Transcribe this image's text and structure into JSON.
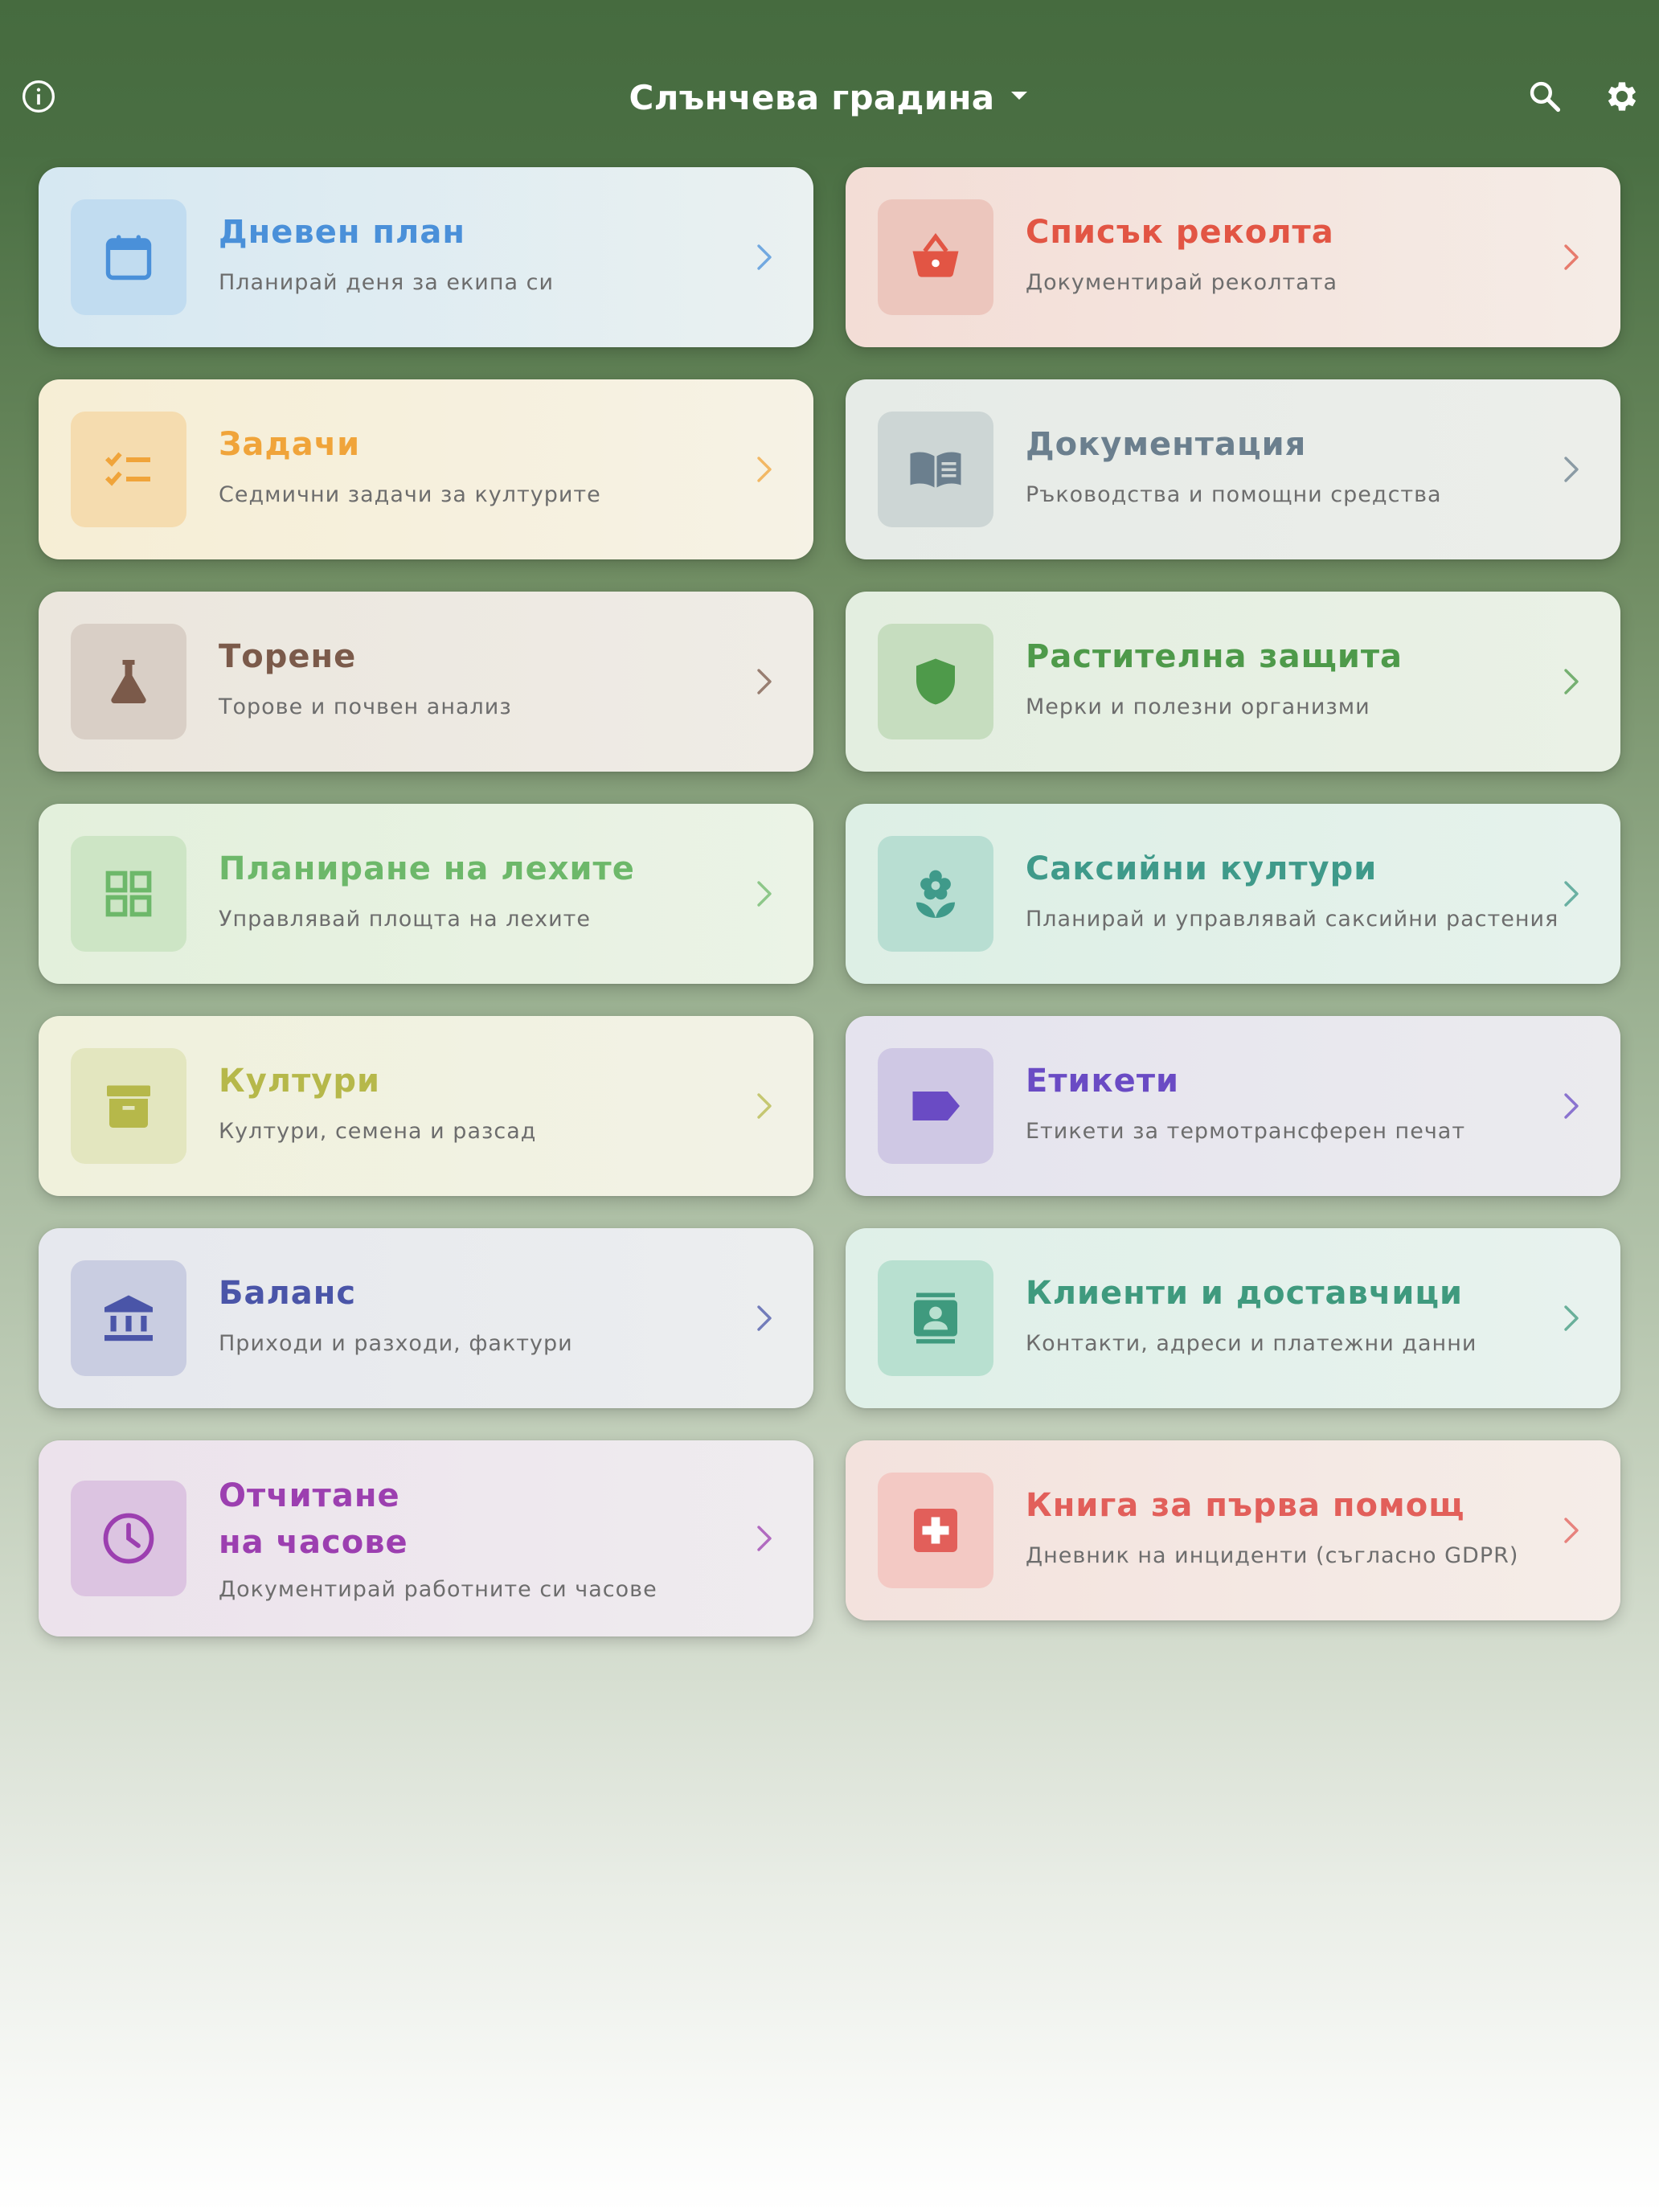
{
  "header": {
    "title": "Слънчева градина",
    "info_icon": "info-icon",
    "dropdown_icon": "caret-down-icon",
    "search_icon": "search-icon",
    "settings_icon": "gear-icon"
  },
  "cards": [
    {
      "id": "daily-plan",
      "title": "Дневен план",
      "subtitle": "Планирай деня за екипа си",
      "icon": "calendar-icon",
      "accent": "#4a90d9"
    },
    {
      "id": "harvest-list",
      "title": "Списък реколта",
      "subtitle": "Документирай реколтата",
      "icon": "basket-icon",
      "accent": "#e25544"
    },
    {
      "id": "tasks",
      "title": "Задачи",
      "subtitle": "Седмични задачи за културите",
      "icon": "checklist-icon",
      "accent": "#f0a43a"
    },
    {
      "id": "documentation",
      "title": "Документация",
      "subtitle": "Ръководства и помощни средства",
      "icon": "book-icon",
      "accent": "#6b7f8e"
    },
    {
      "id": "fertilizing",
      "title": "Торене",
      "subtitle": "Торове и почвен анализ",
      "icon": "flask-icon",
      "accent": "#7b5a4a"
    },
    {
      "id": "plant-protection",
      "title": "Растителна защита",
      "subtitle": "Мерки и полезни организми",
      "icon": "shield-icon",
      "accent": "#4e9a4a"
    },
    {
      "id": "bed-planning",
      "title": "Планиране на лехите",
      "subtitle": "Управлявай площта на лехите",
      "icon": "grid-icon",
      "accent": "#6db86a"
    },
    {
      "id": "potted-crops",
      "title": "Саксийни култури",
      "subtitle": "Планирай и управлявай саксийни растения",
      "icon": "flower-icon",
      "accent": "#3f9a8a"
    },
    {
      "id": "crops",
      "title": "Култури",
      "subtitle": "Култури, семена и разсад",
      "icon": "archive-icon",
      "accent": "#b6b84a"
    },
    {
      "id": "labels",
      "title": "Етикети",
      "subtitle": "Етикети за термотрансферен печат",
      "icon": "label-icon",
      "accent": "#6a4bc4"
    },
    {
      "id": "balance",
      "title": "Баланс",
      "subtitle": "Приходи и разходи, фактури",
      "icon": "bank-icon",
      "accent": "#4a55a8"
    },
    {
      "id": "clients",
      "title": "Клиенти и доставчици",
      "subtitle": "Контакти, адреси и платежни данни",
      "icon": "contacts-icon",
      "accent": "#3f9a7e"
    },
    {
      "id": "time-tracking",
      "title": "Отчитане\nна часове",
      "subtitle": "Документирай работните си часове",
      "icon": "clock-icon",
      "accent": "#9c3fb0"
    },
    {
      "id": "first-aid",
      "title": "Книга за първа помощ",
      "subtitle": "Дневник на инциденти (съгласно GDPR)",
      "icon": "medkit-icon",
      "accent": "#e25f5a"
    }
  ]
}
